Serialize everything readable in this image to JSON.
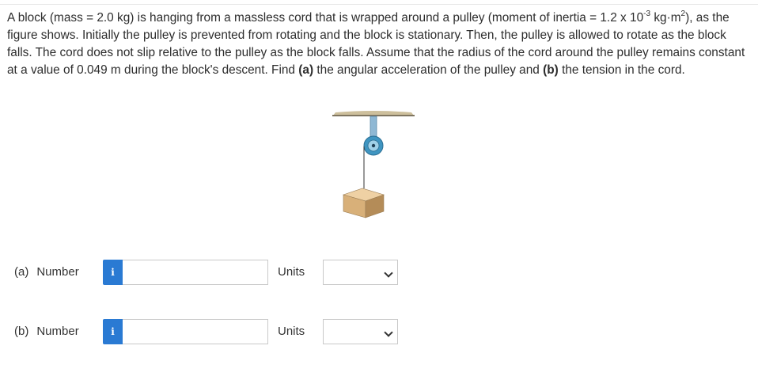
{
  "problem": {
    "p1": "A block (mass = 2.0 kg) is hanging from a massless cord that is wrapped around a pulley (moment of inertia = 1.2 x 10",
    "exp1": "-3",
    "p2": " kg·m",
    "exp2": "2",
    "p3": "), as the figure shows. Initially the pulley is prevented from rotating and the block is stationary. Then, the pulley is allowed to rotate as the block falls. The cord does not slip relative to the pulley as the block falls. Assume that the radius of the cord around the pulley remains constant at a value of 0.049 m during the block's descent. Find ",
    "bold_a": "(a)",
    "p4": " the angular acceleration of the pulley and ",
    "bold_b": "(b)",
    "p5": " the tension in the cord."
  },
  "parts": [
    {
      "letter": "(a)",
      "number_label": "Number",
      "info_icon": "i",
      "value": "",
      "units_label": "Units",
      "units_value": ""
    },
    {
      "letter": "(b)",
      "number_label": "Number",
      "info_icon": "i",
      "value": "",
      "units_label": "Units",
      "units_value": ""
    }
  ],
  "colors": {
    "info_button": "#2a7ad3",
    "block": "#d9b483",
    "ceiling": "#c9b993",
    "pulley": "#4a9fc7"
  }
}
